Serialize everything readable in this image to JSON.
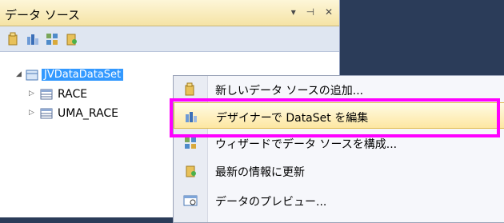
{
  "panel": {
    "title": "データ ソース",
    "header_buttons": [
      "▾",
      "⊣",
      "✕"
    ],
    "toolbar_icons": [
      "add-data-source-icon",
      "edit-dataset-icon",
      "configure-icon",
      "refresh-icon"
    ]
  },
  "tree": {
    "root": "JVDataDataSet",
    "children": [
      "RACE",
      "UMA_RACE"
    ]
  },
  "context_menu": {
    "items": [
      {
        "label": "新しいデータ ソースの追加...",
        "icon": "add-data-source-icon"
      },
      {
        "label": "デザイナーで DataSet を編集",
        "icon": "dataset-designer-icon"
      },
      {
        "label": "ウィザードでデータ ソースを構成...",
        "icon": "wizard-icon"
      },
      {
        "label": "最新の情報に更新",
        "icon": "refresh-icon"
      },
      {
        "label": "データのプレビュー...",
        "icon": "preview-icon"
      }
    ],
    "highlighted_index": 1
  },
  "colors": {
    "accent_highlight": "#ff00ff",
    "selection": "#3399ff",
    "background": "#2b3c59"
  }
}
